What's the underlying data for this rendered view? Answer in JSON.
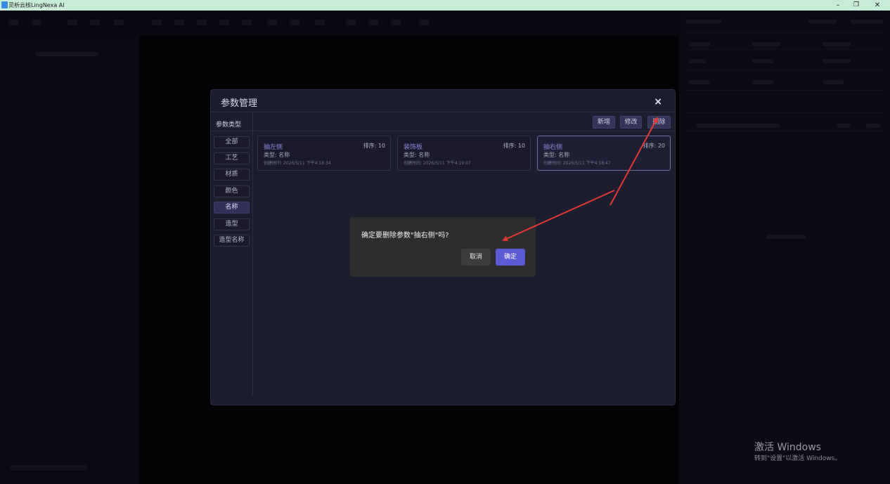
{
  "window": {
    "title": "灵析云核LingNexa AI",
    "minimize_glyph": "–",
    "maximize_glyph": "❐",
    "close_glyph": "✕"
  },
  "modal": {
    "title": "参数管理",
    "close_glyph": "×",
    "types_header": "参数类型",
    "types": [
      {
        "label": "全部"
      },
      {
        "label": "工艺"
      },
      {
        "label": "材质"
      },
      {
        "label": "颜色"
      },
      {
        "label": "名称"
      },
      {
        "label": "造型"
      },
      {
        "label": "造型名称"
      }
    ],
    "active_type": "名称",
    "actions": {
      "add": "新增",
      "edit": "修改",
      "delete": "删除"
    },
    "cards": [
      {
        "name": "抽左侧",
        "sort": "排序: 10",
        "type": "类型: 名称",
        "time": "创建时间: 2026/5/11 下午4:18:34"
      },
      {
        "name": "装饰板",
        "sort": "排序: 10",
        "type": "类型: 名称",
        "time": "创建时间: 2026/5/11 下午4:19:07"
      },
      {
        "name": "抽右侧",
        "sort": "排序: 20",
        "type": "类型: 名称",
        "time": "创建时间: 2026/5/11 下午4:18:47"
      }
    ],
    "selected_card": "抽右侧"
  },
  "confirm": {
    "message": "确定要删除参数\"抽右侧\"吗?",
    "cancel": "取消",
    "ok": "确定"
  },
  "watermark": {
    "title": "激活 Windows",
    "subtitle": "转到\"设置\"以激活 Windows。"
  },
  "colors": {
    "accent": "#5b5bd6",
    "annotation_arrow": "#e53935",
    "modal_bg": "#1d1d30",
    "titlebar_bg": "#c9ecd6"
  }
}
